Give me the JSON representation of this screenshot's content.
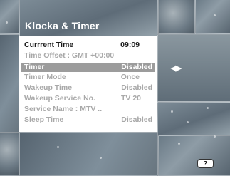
{
  "menu": {
    "title": "Klocka & Timer",
    "current_time": {
      "label": "Currrent Time",
      "value": "09:09"
    },
    "time_offset": {
      "label": "Time Offset : GMT +00:00"
    },
    "items": [
      {
        "label": "Timer",
        "value": "Disabled"
      },
      {
        "label": "Timer Mode",
        "value": "Once"
      },
      {
        "label": "Wakeup Time",
        "value": "Disabled"
      },
      {
        "label": "Wakeup Service No.",
        "value": "TV 20"
      },
      {
        "label": "Service Name : MTV ..",
        "value": ""
      },
      {
        "label": "Sleep Time",
        "value": "Disabled"
      }
    ]
  },
  "nav": {
    "arrows": "◀▶"
  },
  "help": {
    "label": "?"
  },
  "colors": {
    "panel": "#ffffff",
    "highlight": "#9c9c9c",
    "dim_text": "#a9a9a9"
  }
}
